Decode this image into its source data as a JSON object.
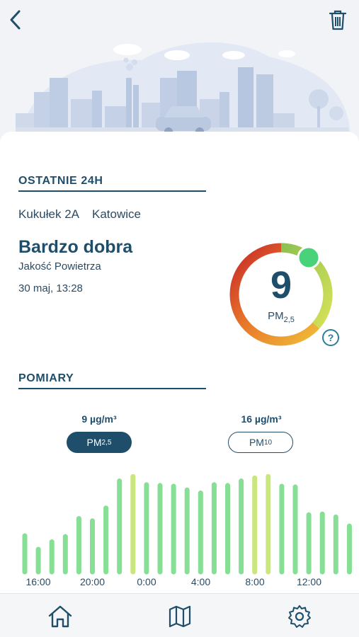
{
  "header": {
    "back_icon": "chevron-left-icon",
    "trash_icon": "trash-icon"
  },
  "last24": {
    "title": "OSTATNIE 24H",
    "street": "Kukułek 2A",
    "city": "Katowice",
    "quality_label": "Bardzo dobra",
    "quality_caption": "Jakość Powietrza",
    "timestamp": "30 maj, 13:28",
    "gauge_value": "9",
    "gauge_unit_main": "PM",
    "gauge_unit_sub": "2,5",
    "help_symbol": "?"
  },
  "measurements": {
    "title": "POMIARY",
    "pm25_value": "9 µg/m³",
    "pm10_value": "16 µg/m³",
    "pm25_main": "PM",
    "pm25_sub": "2,5",
    "pm10_main": "PM",
    "pm10_sub": "10"
  },
  "chart_data": {
    "type": "bar",
    "x_tick_labels": [
      "16:00",
      "20:00",
      "0:00",
      "4:00",
      "8:00",
      "12:00"
    ],
    "values": [
      48,
      30,
      40,
      47,
      71,
      68,
      85,
      121,
      127,
      116,
      115,
      114,
      109,
      105,
      116,
      115,
      121,
      125,
      127,
      114,
      113,
      76,
      77,
      73,
      61
    ],
    "colors": [
      "green",
      "green",
      "green",
      "green",
      "green",
      "green",
      "green",
      "green",
      "lime",
      "green",
      "green",
      "green",
      "green",
      "green",
      "green",
      "green",
      "green",
      "lime",
      "lime",
      "green",
      "green",
      "green",
      "green",
      "green",
      "green"
    ],
    "palette": {
      "green": "#86df94",
      "lime": "#c9e67f"
    },
    "ylim": [
      0,
      130
    ]
  },
  "nav": {
    "home_icon": "home-icon",
    "map_icon": "map-icon",
    "settings_icon": "settings-icon"
  }
}
